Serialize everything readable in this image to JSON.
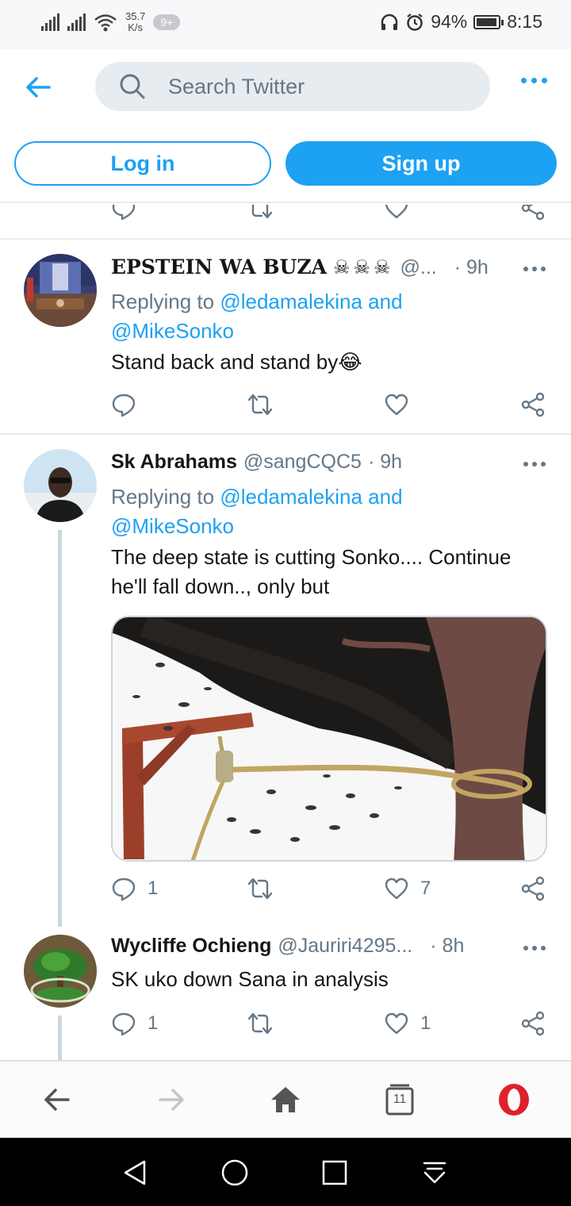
{
  "status": {
    "speed_value": "35.7",
    "speed_unit": "K/s",
    "notif_badge": "9+",
    "battery": "94%",
    "battery_level": 0.94,
    "time": "8:15"
  },
  "header": {
    "search_placeholder": "Search Twitter"
  },
  "auth": {
    "login_label": "Log in",
    "signup_label": "Sign up"
  },
  "tweets": [
    {
      "name": "EPSTEIN WA BUZA",
      "name_suffix": "☠☠☠",
      "handle": "@...",
      "time": "· 9h",
      "reply_prefix": "Replying to",
      "mention1": "@ledamalekina",
      "mention_join": "and",
      "mention2": "@MikeSonko",
      "text": "Stand back and stand by😂",
      "reply_count": "",
      "like_count": ""
    },
    {
      "name": "Sk Abrahams",
      "handle": "@sangCQC5",
      "time": "· 9h",
      "reply_prefix": "Replying to",
      "mention1": "@ledamalekina",
      "mention_join": "and",
      "mention2": "@MikeSonko",
      "text": "The deep state is cutting Sonko.... Continue he'll fall down.., only but",
      "reply_count": "1",
      "like_count": "7"
    },
    {
      "name": "Wycliffe Ochieng",
      "handle": "@Jauriri4295...",
      "time": "· 8h",
      "text": "SK uko down Sana in analysis",
      "reply_count": "1",
      "like_count": "1"
    }
  ],
  "browser": {
    "tabs_count": "11"
  },
  "colors": {
    "accent": "#1da1f2",
    "muted": "#657786",
    "opera": "#e0202a"
  }
}
